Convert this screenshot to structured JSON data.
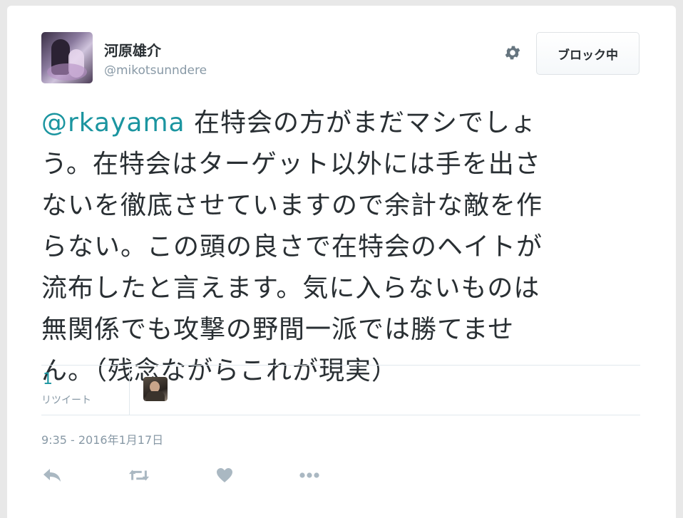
{
  "user": {
    "display_name": "河原雄介",
    "handle": "@mikotsunndere"
  },
  "header": {
    "block_button_label": "ブロック中",
    "gear_icon": "gear-icon"
  },
  "tweet": {
    "mention": "@rkayama",
    "lines": [
      " 在特会の方がまだマシでしょ",
      "う。在特会はターゲット以外には手を出さ",
      "ないを徹底させていますので余計な敵を作",
      "らない。この頭の良さで在特会のヘイトが",
      "流布したと言えます。気に入らないものは",
      "無関係でも攻撃の野間一派では勝てませ",
      "ん。（残念ながらこれが現実）"
    ]
  },
  "stats": {
    "retweet_count": "1",
    "retweet_label": "リツイート"
  },
  "timestamp": "9:35 - 2016年1月17日",
  "actions": [
    {
      "name": "reply-icon"
    },
    {
      "name": "retweet-icon"
    },
    {
      "name": "like-icon"
    },
    {
      "name": "more-icon"
    }
  ],
  "colors": {
    "accent": "#1b95a0",
    "text": "#292f33",
    "muted": "#8899a6",
    "icon": "#aab8c2"
  }
}
